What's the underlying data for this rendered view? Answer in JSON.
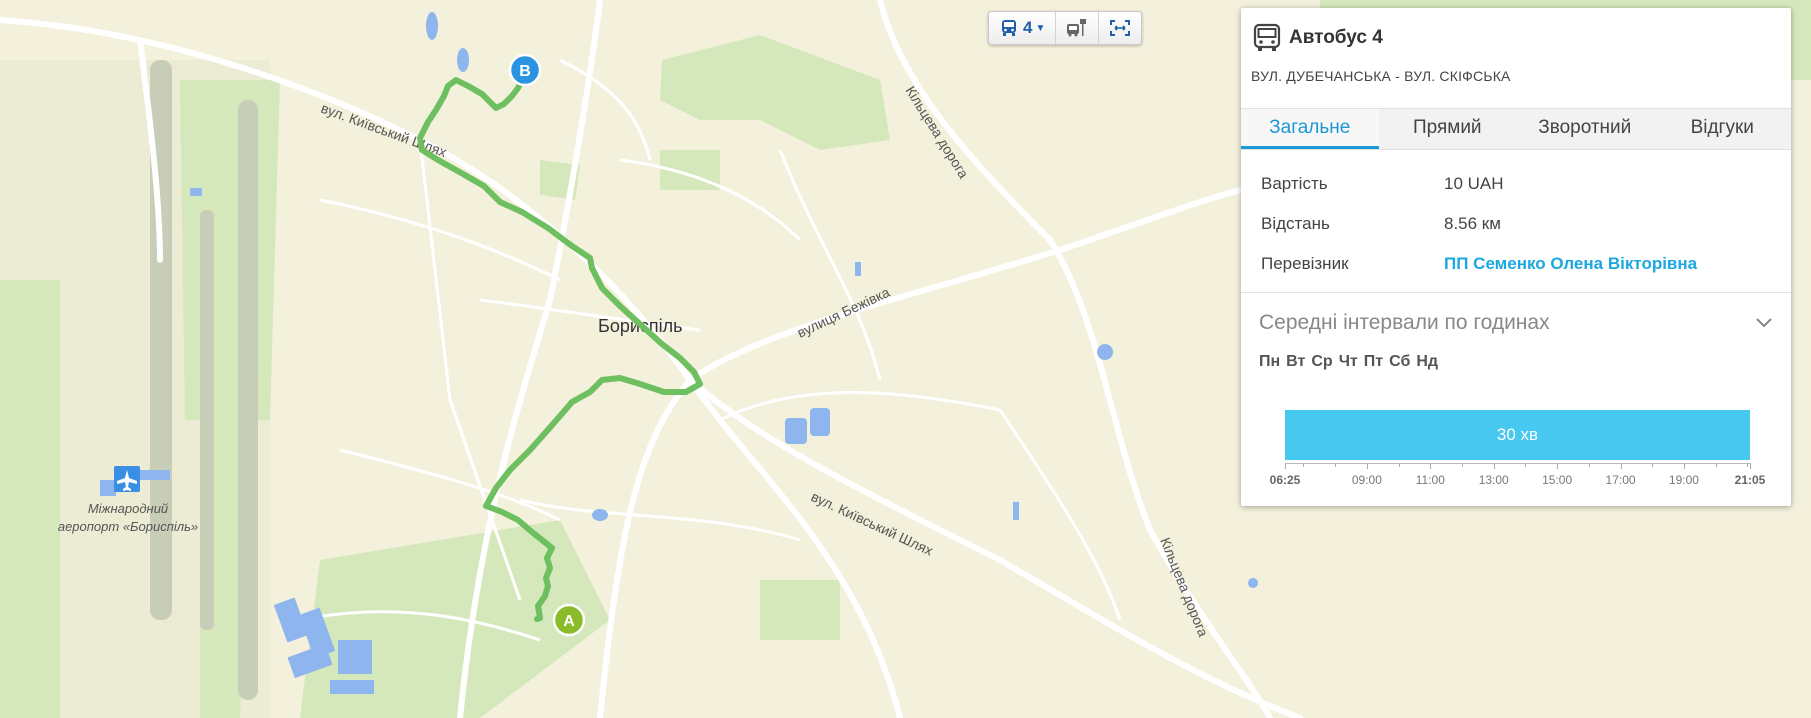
{
  "map": {
    "city_label": "Бориспіль",
    "road_labels": {
      "kyivskyi_north": "вул. Київський Шлях",
      "kyivskyi_south": "вул. Київський Шлях",
      "ring_north": "Кільцева дорога",
      "ring_south": "Кільцева дорога",
      "bezhivka": "вулиця Бежівка"
    },
    "airport_label_line1": "Міжнародний",
    "airport_label_line2": "аеропорт «Бориспіль»",
    "marker_start": "A",
    "marker_end": "B",
    "route_color": "#6ebf5f",
    "water_color": "#8fb5ee",
    "park_color": "#d5e8bc"
  },
  "toolbar": {
    "route_number": "4",
    "icons": [
      "bus-icon",
      "bus-stop-icon",
      "fit-bounds-icon"
    ]
  },
  "panel": {
    "title": "Автобус 4",
    "subtitle": "ВУЛ. ДУБЕЧАНСЬКА - ВУЛ. СКІФСЬКА",
    "tabs": [
      {
        "label": "Загальне",
        "active": true
      },
      {
        "label": "Прямий",
        "active": false
      },
      {
        "label": "Зворотний",
        "active": false
      },
      {
        "label": "Відгуки",
        "active": false
      }
    ],
    "props": [
      {
        "key": "Вартість",
        "value": "10 UAH"
      },
      {
        "key": "Відстань",
        "value": "8.56 км"
      },
      {
        "key": "Перевізник",
        "value": "ПП Семенко Олена Вікторівна"
      }
    ],
    "intervals": {
      "title": "Середні інтервали по годинах",
      "days": [
        "Пн",
        "Вт",
        "Ср",
        "Чт",
        "Пт",
        "Сб",
        "Нд"
      ],
      "bar_label": "30 хв",
      "start": "06:25",
      "end": "21:05",
      "ticks": [
        "09:00",
        "11:00",
        "13:00",
        "15:00",
        "17:00",
        "19:00"
      ],
      "accent": "#46c8f0"
    }
  }
}
